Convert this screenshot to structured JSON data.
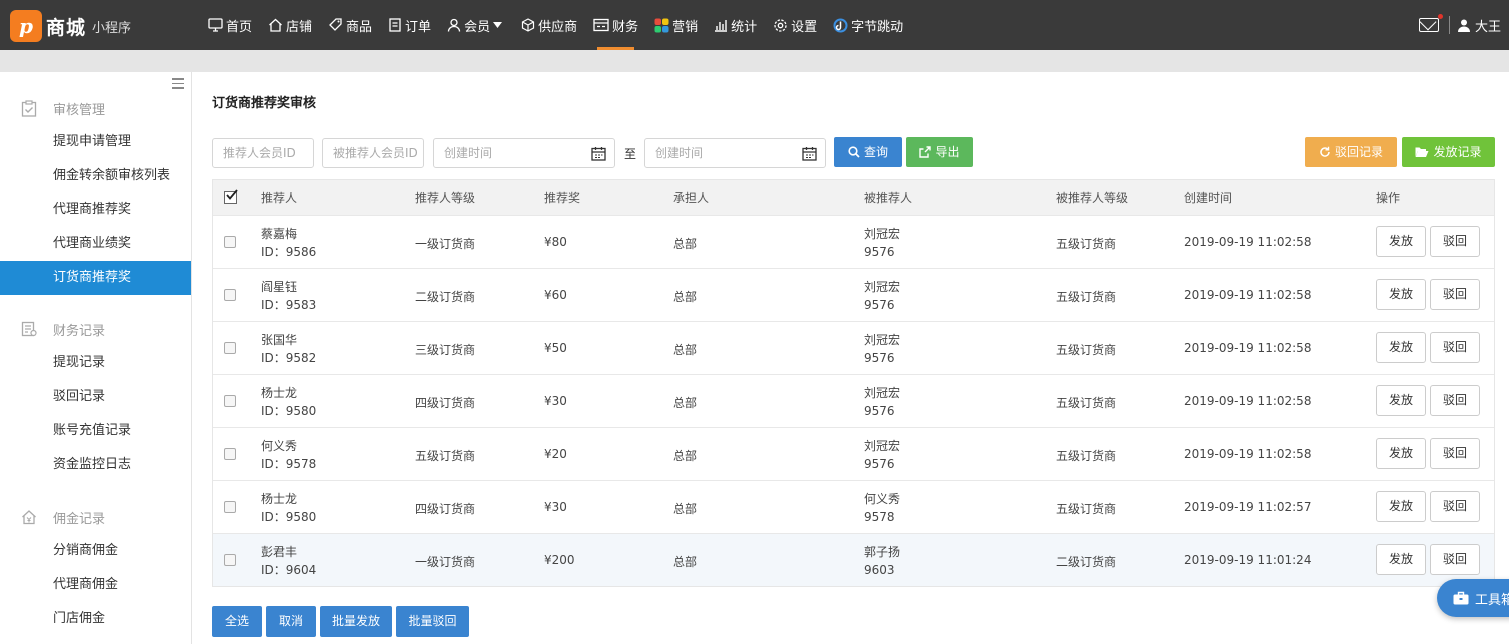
{
  "brand": {
    "logo_letter": "p",
    "name": "商城",
    "sub": "小程序"
  },
  "nav": [
    {
      "label": "首页",
      "icon": "monitor-icon"
    },
    {
      "label": "店铺",
      "icon": "home-icon"
    },
    {
      "label": "商品",
      "icon": "tag-icon"
    },
    {
      "label": "订单",
      "icon": "order-icon"
    },
    {
      "label": "会员",
      "icon": "user-icon",
      "dropdown": true
    },
    {
      "label": "供应商",
      "icon": "cube-icon"
    },
    {
      "label": "财务",
      "icon": "finance-icon",
      "active": true
    },
    {
      "label": "营销",
      "icon": "marketing-icon"
    },
    {
      "label": "统计",
      "icon": "chart-icon"
    },
    {
      "label": "设置",
      "icon": "gear-icon"
    },
    {
      "label": "字节跳动",
      "icon": "bytedance-icon"
    }
  ],
  "user": {
    "name": "大王"
  },
  "sidebar": {
    "groups": [
      {
        "label": "审核管理",
        "icon": "clipboard-check-icon",
        "items": [
          "提现申请管理",
          "佣金转余额审核列表",
          "代理商推荐奖",
          "代理商业绩奖",
          "订货商推荐奖"
        ]
      },
      {
        "label": "财务记录",
        "icon": "ledger-icon",
        "items": [
          "提现记录",
          "驳回记录",
          "账号充值记录",
          "资金监控日志"
        ]
      },
      {
        "label": "佣金记录",
        "icon": "house-yen-icon",
        "items": [
          "分销商佣金",
          "代理商佣金",
          "门店佣金"
        ]
      }
    ],
    "active_item": "订货商推荐奖"
  },
  "page": {
    "title": "订货商推荐奖审核",
    "filters": {
      "referrer_id_placeholder": "推荐人会员ID",
      "referee_id_placeholder": "被推荐人会员ID",
      "start_placeholder": "创建时间",
      "end_placeholder": "创建时间",
      "to_label": "至",
      "search_label": "查询",
      "export_label": "导出",
      "reject_records_label": "驳回记录",
      "issue_records_label": "发放记录"
    },
    "table": {
      "columns": [
        "推荐人",
        "推荐人等级",
        "推荐奖",
        "承担人",
        "被推荐人",
        "被推荐人等级",
        "创建时间",
        "操作"
      ],
      "rows": [
        {
          "name": "蔡嘉梅",
          "id": "ID：9586",
          "level": "一级订货商",
          "reward": "¥80",
          "bearer": "总部",
          "referee_name": "刘冠宏",
          "referee_id": "9576",
          "referee_level": "五级订货商",
          "time": "2019-09-19 11:02:58"
        },
        {
          "name": "阎星钰",
          "id": "ID：9583",
          "level": "二级订货商",
          "reward": "¥60",
          "bearer": "总部",
          "referee_name": "刘冠宏",
          "referee_id": "9576",
          "referee_level": "五级订货商",
          "time": "2019-09-19 11:02:58"
        },
        {
          "name": "张国华",
          "id": "ID：9582",
          "level": "三级订货商",
          "reward": "¥50",
          "bearer": "总部",
          "referee_name": "刘冠宏",
          "referee_id": "9576",
          "referee_level": "五级订货商",
          "time": "2019-09-19 11:02:58"
        },
        {
          "name": "杨士龙",
          "id": "ID：9580",
          "level": "四级订货商",
          "reward": "¥30",
          "bearer": "总部",
          "referee_name": "刘冠宏",
          "referee_id": "9576",
          "referee_level": "五级订货商",
          "time": "2019-09-19 11:02:58"
        },
        {
          "name": "何义秀",
          "id": "ID：9578",
          "level": "五级订货商",
          "reward": "¥20",
          "bearer": "总部",
          "referee_name": "刘冠宏",
          "referee_id": "9576",
          "referee_level": "五级订货商",
          "time": "2019-09-19 11:02:58"
        },
        {
          "name": "杨士龙",
          "id": "ID：9580",
          "level": "四级订货商",
          "reward": "¥30",
          "bearer": "总部",
          "referee_name": "何义秀",
          "referee_id": "9578",
          "referee_level": "五级订货商",
          "time": "2019-09-19 11:02:57"
        },
        {
          "name": "彭君丰",
          "id": "ID：9604",
          "level": "一级订货商",
          "reward": "¥200",
          "bearer": "总部",
          "referee_name": "郭子扬",
          "referee_id": "9603",
          "referee_level": "二级订货商",
          "time": "2019-09-19 11:01:24"
        }
      ],
      "action_issue": "发放",
      "action_reject": "驳回"
    },
    "bulk": {
      "select_all": "全选",
      "cancel": "取消",
      "batch_issue": "批量发放",
      "batch_reject": "批量驳回"
    },
    "toolbox_label": "工具箱"
  },
  "colors": {
    "topbar": "#3a3a3a",
    "accent": "#1f8bd5",
    "nav_active": "#f08d30",
    "primary_button": "#3a84d0",
    "export_button": "#5cb85c",
    "reject_records_button": "#f0ad4e",
    "issue_records_button": "#70c33a",
    "brand": "#f47d20"
  }
}
